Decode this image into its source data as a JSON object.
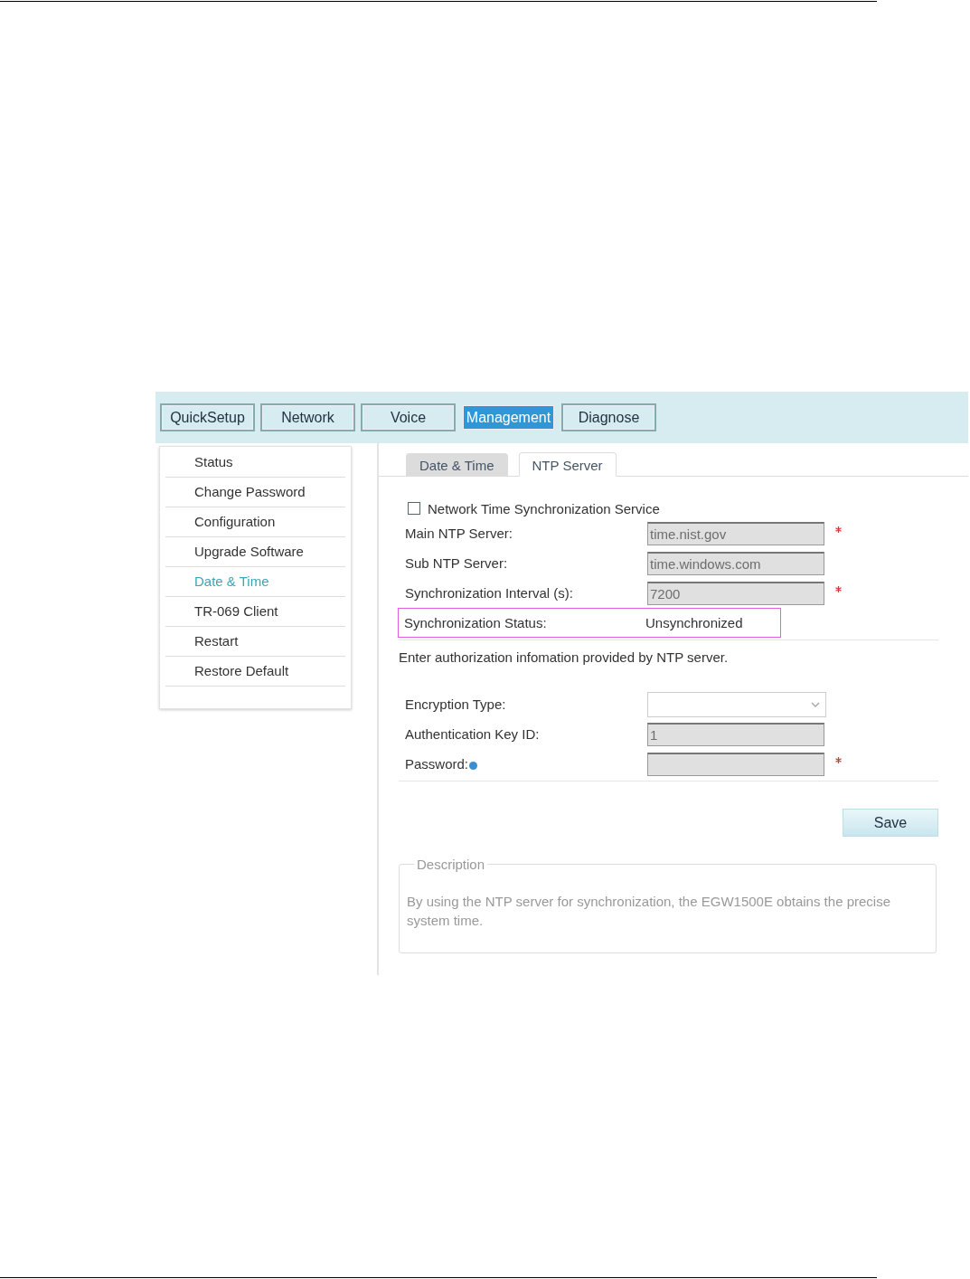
{
  "top_tabs": [
    {
      "label": "QuickSetup",
      "selected": false
    },
    {
      "label": "Network",
      "selected": false
    },
    {
      "label": "Voice",
      "selected": false
    },
    {
      "label": "Management",
      "selected": true
    },
    {
      "label": "Diagnose",
      "selected": false
    }
  ],
  "sidebar": {
    "items": [
      {
        "label": "Status",
        "selected": false
      },
      {
        "label": "Change Password",
        "selected": false
      },
      {
        "label": "Configuration",
        "selected": false
      },
      {
        "label": "Upgrade Software",
        "selected": false
      },
      {
        "label": "Date & Time",
        "selected": true
      },
      {
        "label": "TR-069 Client",
        "selected": false
      },
      {
        "label": "Restart",
        "selected": false
      },
      {
        "label": "Restore Default",
        "selected": false
      }
    ]
  },
  "sub_tabs": [
    {
      "label": "Date & Time",
      "selected": false
    },
    {
      "label": "NTP Server",
      "selected": true
    }
  ],
  "service_checkbox": {
    "label": "Network Time Synchronization Service",
    "checked": false
  },
  "server_fields": [
    {
      "kind": "input",
      "label": "Main NTP Server:",
      "value": "time.nist.gov",
      "required": true,
      "disabled": true,
      "highlighted": false
    },
    {
      "kind": "input",
      "label": "Sub NTP Server:",
      "value": "time.windows.com",
      "required": false,
      "disabled": true,
      "highlighted": false
    },
    {
      "kind": "input",
      "label": "Synchronization Interval (s):",
      "value": "7200",
      "required": true,
      "disabled": true,
      "highlighted": false
    },
    {
      "kind": "text",
      "label": "Synchronization Status:",
      "value": "Unsynchronized",
      "required": false,
      "highlighted": true
    }
  ],
  "auth_note": "Enter authorization infomation provided by NTP server.",
  "auth_fields": [
    {
      "kind": "select",
      "label": "Encryption Type:",
      "required": false,
      "highlighted": false,
      "help": false
    },
    {
      "kind": "input",
      "label": "Authentication Key ID:",
      "value": "1",
      "required": false,
      "disabled": true,
      "highlighted": false,
      "help": false
    },
    {
      "kind": "input",
      "label": "Password:",
      "required": true,
      "disabled": true,
      "highlighted": false,
      "help": true
    }
  ],
  "save_button": "Save",
  "description": {
    "title": "Description",
    "text": "By using the NTP server for synchronization, the EGW1500E obtains the precise system time."
  }
}
